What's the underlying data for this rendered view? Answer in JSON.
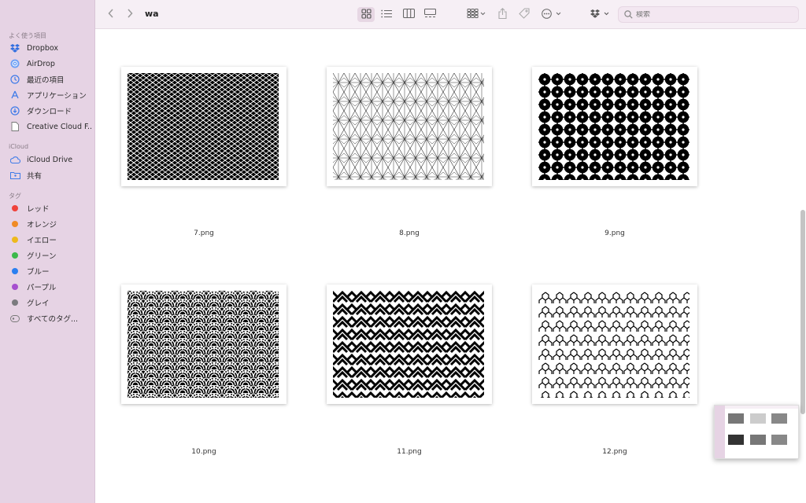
{
  "window": {
    "title": "wa"
  },
  "toolbar": {
    "search_placeholder": "検索",
    "icons": [
      "chevron-left-icon",
      "chevron-right-icon",
      "icon-view-icon",
      "list-view-icon",
      "column-view-icon",
      "gallery-view-icon",
      "group-icon",
      "share-icon",
      "tag-icon",
      "more-icon",
      "dropbox-icon",
      "search-icon"
    ]
  },
  "sidebar": {
    "favorites_title": "よく使う項目",
    "favorites": [
      {
        "label": "Dropbox",
        "icon": "dropbox-icon"
      },
      {
        "label": "AirDrop",
        "icon": "airdrop-icon"
      },
      {
        "label": "最近の項目",
        "icon": "clock-icon"
      },
      {
        "label": "アプリケーション",
        "icon": "applications-icon"
      },
      {
        "label": "ダウンロード",
        "icon": "download-icon"
      },
      {
        "label": "Creative Cloud F...",
        "icon": "document-icon"
      }
    ],
    "icloud_title": "iCloud",
    "icloud": [
      {
        "label": "iCloud Drive",
        "icon": "cloud-icon"
      },
      {
        "label": "共有",
        "icon": "shared-folder-icon"
      }
    ],
    "tags_title": "タグ",
    "tags": [
      {
        "label": "レッド",
        "color": "#f0423b"
      },
      {
        "label": "オレンジ",
        "color": "#f08a24"
      },
      {
        "label": "イエロー",
        "color": "#eeb91c"
      },
      {
        "label": "グリーン",
        "color": "#3cb94a"
      },
      {
        "label": "ブルー",
        "color": "#2b7ff0"
      },
      {
        "label": "パープル",
        "color": "#a64fcf"
      },
      {
        "label": "グレイ",
        "color": "#7b7b7f"
      },
      {
        "label": "すべてのタグ...",
        "color": "",
        "icon": "all-tags-icon"
      }
    ]
  },
  "files": [
    {
      "name": "7.png",
      "pattern": "lattice"
    },
    {
      "name": "8.png",
      "pattern": "asanoha"
    },
    {
      "name": "9.png",
      "pattern": "shippo"
    },
    {
      "name": "10.png",
      "pattern": "seigaiha"
    },
    {
      "name": "11.png",
      "pattern": "sayagata"
    },
    {
      "name": "12.png",
      "pattern": "kikko"
    }
  ]
}
